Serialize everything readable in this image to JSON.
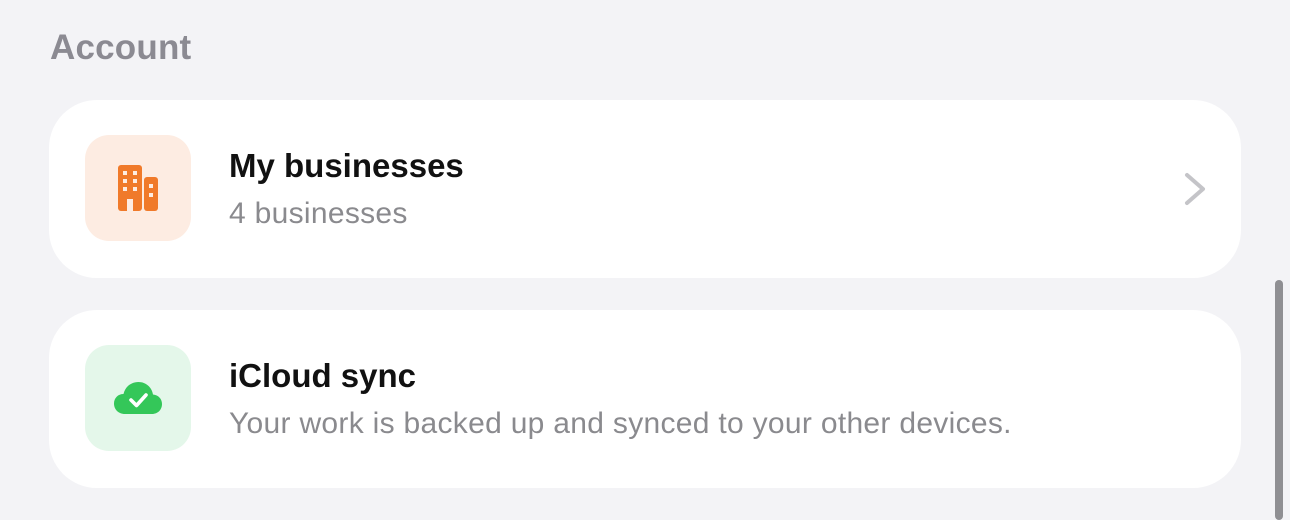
{
  "section": {
    "title": "Account"
  },
  "rows": [
    {
      "title": "My businesses",
      "subtitle": "4 businesses",
      "icon": "building-icon",
      "icon_color": "#f07a2a",
      "tile_color": "#fdece2",
      "has_chevron": true
    },
    {
      "title": "iCloud sync",
      "subtitle": "Your work is backed up and synced to your other devices.",
      "icon": "cloud-check-icon",
      "icon_color": "#34c759",
      "tile_color": "#e4f7ea",
      "has_chevron": false
    }
  ],
  "colors": {
    "background": "#f3f3f6",
    "card": "#ffffff",
    "section_title": "#8b8a92",
    "subtitle": "#8a8a8e",
    "chevron": "#c4c4c8"
  }
}
